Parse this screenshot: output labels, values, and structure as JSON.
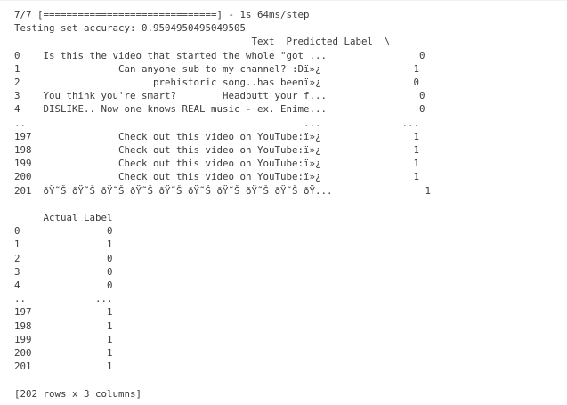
{
  "output": {
    "text": "7/7 [==============================] - 1s 64ms/step\nTesting set accuracy: 0.9504950495049505\n                                         Text  Predicted Label  \\\n0    Is this the video that started the whole \"got ...                0\n1                 Can anyone sub to my channel? :Dï»¿                1\n2                       prehistoric song..has beenï»¿                0\n3    You think you're smart?        Headbutt your f...                0\n4    DISLIKE.. Now one knows REAL music - ex. Enime...                0\n..                                                ...              ...\n197               Check out this video on YouTube:ï»¿                1\n198               Check out this video on YouTube:ï»¿                1\n199               Check out this video on YouTube:ï»¿                1\n200               Check out this video on YouTube:ï»¿                1\n201  ðŸ˜Š ðŸ˜Š ðŸ˜Š ðŸ˜Š ðŸ˜Š ðŸ˜Š ðŸ˜Š ðŸ˜Š ðŸ˜Š ðŸ...                1\n\n     Actual Label\n0               0\n1               1\n2               0\n3               0\n4               0\n..            ...\n197             1\n198             1\n199             1\n200             1\n201             1\n\n[202 rows x 3 columns]"
  }
}
